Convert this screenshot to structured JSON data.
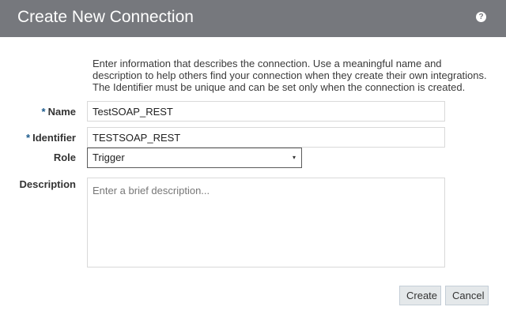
{
  "dialog": {
    "title": "Create New Connection",
    "help_icon": "question-mark-circle-icon",
    "intro": "Enter information that describes the connection. Use a meaningful name and description to help others find your connection when they create their own integrations. The Identifier must be unique and can be set only when the connection is created."
  },
  "form": {
    "required_marker": "*",
    "name": {
      "label": "Name",
      "value": "TestSOAP_REST",
      "required": true
    },
    "identifier": {
      "label": "Identifier",
      "value": "TESTSOAP_REST",
      "required": true
    },
    "role": {
      "label": "Role",
      "selected": "Trigger",
      "arrow": "▾"
    },
    "description": {
      "label": "Description",
      "value": "",
      "placeholder": "Enter a brief description..."
    }
  },
  "buttons": {
    "create": "Create",
    "cancel": "Cancel"
  },
  "colors": {
    "header_bg": "#76787d",
    "required_star": "#1b5a8c",
    "button_bg": "#e4e8ea"
  }
}
